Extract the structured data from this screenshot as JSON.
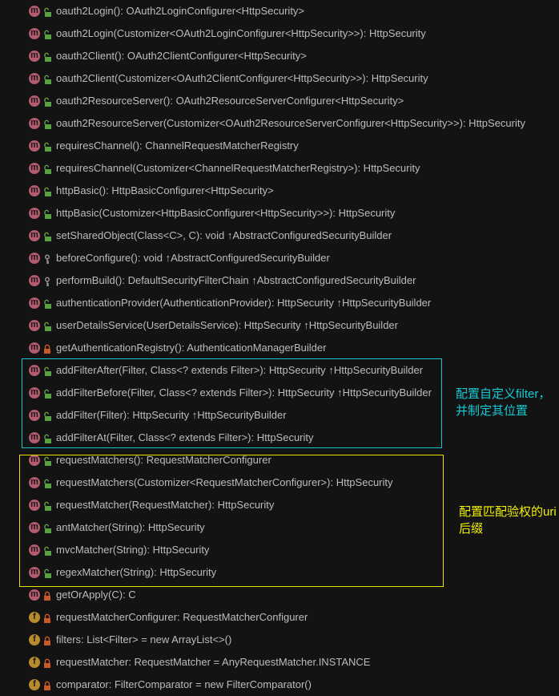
{
  "colors": {
    "method": "#b55b6f",
    "field": "#b88a2c",
    "public": "#5aa040",
    "private": "#c8582a",
    "protected": "#9a9a9a",
    "cyan_box": "#16c6cf",
    "yellow_box": "#e8e600"
  },
  "members": [
    {
      "kind": "m",
      "access": "public",
      "text": "oauth2Login(): OAuth2LoginConfigurer<HttpSecurity>",
      "inherited": ""
    },
    {
      "kind": "m",
      "access": "public",
      "text": "oauth2Login(Customizer<OAuth2LoginConfigurer<HttpSecurity>>): HttpSecurity",
      "inherited": ""
    },
    {
      "kind": "m",
      "access": "public",
      "text": "oauth2Client(): OAuth2ClientConfigurer<HttpSecurity>",
      "inherited": ""
    },
    {
      "kind": "m",
      "access": "public",
      "text": "oauth2Client(Customizer<OAuth2ClientConfigurer<HttpSecurity>>): HttpSecurity",
      "inherited": ""
    },
    {
      "kind": "m",
      "access": "public",
      "text": "oauth2ResourceServer(): OAuth2ResourceServerConfigurer<HttpSecurity>",
      "inherited": ""
    },
    {
      "kind": "m",
      "access": "public",
      "text": "oauth2ResourceServer(Customizer<OAuth2ResourceServerConfigurer<HttpSecurity>>): HttpSecurity",
      "inherited": ""
    },
    {
      "kind": "m",
      "access": "public",
      "text": "requiresChannel(): ChannelRequestMatcherRegistry",
      "inherited": ""
    },
    {
      "kind": "m",
      "access": "public",
      "text": "requiresChannel(Customizer<ChannelRequestMatcherRegistry>): HttpSecurity",
      "inherited": ""
    },
    {
      "kind": "m",
      "access": "public",
      "text": "httpBasic(): HttpBasicConfigurer<HttpSecurity>",
      "inherited": ""
    },
    {
      "kind": "m",
      "access": "public",
      "text": "httpBasic(Customizer<HttpBasicConfigurer<HttpSecurity>>): HttpSecurity",
      "inherited": ""
    },
    {
      "kind": "m",
      "access": "public",
      "text": "setSharedObject(Class<C>, C): void",
      "inherited": "↑AbstractConfiguredSecurityBuilder"
    },
    {
      "kind": "m",
      "access": "protected",
      "text": "beforeConfigure(): void",
      "inherited": "↑AbstractConfiguredSecurityBuilder"
    },
    {
      "kind": "m",
      "access": "protected",
      "text": "performBuild(): DefaultSecurityFilterChain",
      "inherited": "↑AbstractConfiguredSecurityBuilder"
    },
    {
      "kind": "m",
      "access": "public",
      "text": "authenticationProvider(AuthenticationProvider): HttpSecurity",
      "inherited": "↑HttpSecurityBuilder"
    },
    {
      "kind": "m",
      "access": "public",
      "text": "userDetailsService(UserDetailsService): HttpSecurity",
      "inherited": "↑HttpSecurityBuilder"
    },
    {
      "kind": "m",
      "access": "private",
      "text": "getAuthenticationRegistry(): AuthenticationManagerBuilder",
      "inherited": ""
    },
    {
      "kind": "m",
      "access": "public",
      "text": "addFilterAfter(Filter, Class<? extends Filter>): HttpSecurity",
      "inherited": "↑HttpSecurityBuilder"
    },
    {
      "kind": "m",
      "access": "public",
      "text": "addFilterBefore(Filter, Class<? extends Filter>): HttpSecurity",
      "inherited": "↑HttpSecurityBuilder"
    },
    {
      "kind": "m",
      "access": "public",
      "text": "addFilter(Filter): HttpSecurity",
      "inherited": "↑HttpSecurityBuilder"
    },
    {
      "kind": "m",
      "access": "public",
      "text": "addFilterAt(Filter, Class<? extends Filter>): HttpSecurity",
      "inherited": ""
    },
    {
      "kind": "m",
      "access": "public",
      "text": "requestMatchers(): RequestMatcherConfigurer",
      "inherited": ""
    },
    {
      "kind": "m",
      "access": "public",
      "text": "requestMatchers(Customizer<RequestMatcherConfigurer>): HttpSecurity",
      "inherited": ""
    },
    {
      "kind": "m",
      "access": "public",
      "text": "requestMatcher(RequestMatcher): HttpSecurity",
      "inherited": ""
    },
    {
      "kind": "m",
      "access": "public",
      "text": "antMatcher(String): HttpSecurity",
      "inherited": ""
    },
    {
      "kind": "m",
      "access": "public",
      "text": "mvcMatcher(String): HttpSecurity",
      "inherited": ""
    },
    {
      "kind": "m",
      "access": "public",
      "text": "regexMatcher(String): HttpSecurity",
      "inherited": ""
    },
    {
      "kind": "m",
      "access": "private",
      "text": "getOrApply(C): C",
      "inherited": ""
    },
    {
      "kind": "f",
      "access": "private",
      "text": "requestMatcherConfigurer: RequestMatcherConfigurer",
      "inherited": ""
    },
    {
      "kind": "f",
      "access": "private",
      "text": "filters: List<Filter> = new ArrayList<>()",
      "inherited": ""
    },
    {
      "kind": "f",
      "access": "private",
      "text": "requestMatcher: RequestMatcher = AnyRequestMatcher.INSTANCE",
      "inherited": ""
    },
    {
      "kind": "f",
      "access": "private",
      "text": "comparator: FilterComparator = new FilterComparator()",
      "inherited": ""
    }
  ],
  "annotations": {
    "filter_note": "配置自定义filter，并制定其位置",
    "matcher_note": "配置匹配验权的uri后缀"
  }
}
